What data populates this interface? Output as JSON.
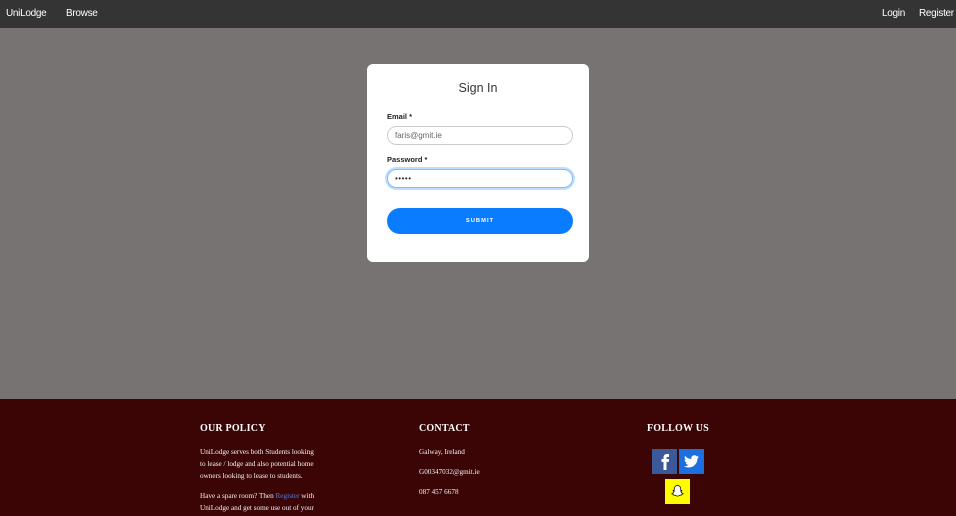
{
  "nav": {
    "brand": "UniLodge",
    "browse": "Browse",
    "login": "Login",
    "register": "Register"
  },
  "signin": {
    "title": "Sign In",
    "email_label": "Email *",
    "email_value": "faris@gmit.ie",
    "password_label": "Password *",
    "password_value": "•••••",
    "submit_label": "SUBMIT"
  },
  "footer": {
    "policy": {
      "heading": "OUR POLICY",
      "para1_lines": [
        "UniLodge serves both Students looking",
        "to lease / lodge and also potential home",
        "owners looking to lease to students."
      ],
      "para2_line1_before": "Have a spare room? Then ",
      "para2_link": "Register",
      "para2_line1_after": " with",
      "para2_line2": "UniLodge and get some use out of your"
    },
    "contact": {
      "heading": "CONTACT",
      "location": "Galway, Ireland",
      "email": "G00347032@gmit.ie",
      "phone": "087 457 6678"
    },
    "follow": {
      "heading": "FOLLOW US",
      "icons": [
        "facebook-icon",
        "twitter-icon",
        "snapchat-icon"
      ]
    }
  },
  "colors": {
    "navbar": "#343434",
    "page_bg": "#767372",
    "footer_bg": "#3c0505",
    "submit": "#0a7cff",
    "facebook": "#3b5998",
    "twitter": "#1d6fe0",
    "snapchat": "#fffc00"
  }
}
